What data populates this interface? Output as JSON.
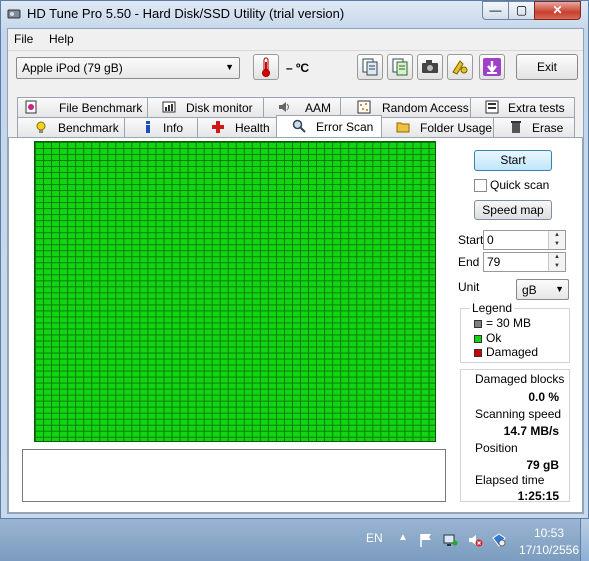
{
  "window": {
    "title": "HD Tune Pro 5.50 - Hard Disk/SSD Utility (trial version)"
  },
  "titlebar_buttons": {
    "minimize": "—",
    "maximize": "▢",
    "close": "✕"
  },
  "menu": {
    "file": "File",
    "help": "Help"
  },
  "toolbar": {
    "drive": "Apple   iPod (79 gB)",
    "temperature": "– ºC",
    "exit_label": "Exit",
    "icons": [
      "copy-info-icon",
      "copy-text-icon",
      "camera-icon",
      "settings-icon",
      "save-icon"
    ]
  },
  "tabs": {
    "row1": [
      "File Benchmark",
      "Disk monitor",
      "AAM",
      "Random Access",
      "Extra tests"
    ],
    "row2": [
      "Benchmark",
      "Info",
      "Health",
      "Error Scan",
      "Folder Usage",
      "Erase"
    ],
    "active": "Error Scan"
  },
  "scan": {
    "start_button": "Start",
    "quick_scan_label": "Quick scan",
    "quick_scan_checked": false,
    "speed_map_button": "Speed map",
    "start_label": "Start",
    "start_value": "0",
    "end_label": "End",
    "end_value": "79",
    "unit_label": "Unit",
    "unit_value": "gB",
    "grid_blocks": {
      "columns": 50,
      "rows": 50,
      "status": "Ok"
    }
  },
  "legend": {
    "title": "Legend",
    "items": [
      {
        "label": "= 30 MB",
        "color": "#808080"
      },
      {
        "label": "Ok",
        "color": "#12d412"
      },
      {
        "label": "Damaged",
        "color": "#cc0000"
      }
    ]
  },
  "stats": {
    "damaged_label": "Damaged blocks",
    "damaged_value": "0.0 %",
    "speed_label": "Scanning speed",
    "speed_value": "14.7 MB/s",
    "position_label": "Position",
    "position_value": "79 gB",
    "elapsed_label": "Elapsed time",
    "elapsed_value": "1:25:15"
  },
  "taskbar": {
    "language": "EN",
    "time": "10:53",
    "date": "17/10/2556",
    "tray_icons": [
      "show-hidden-icons-icon",
      "action-center-flag-icon",
      "network-icon",
      "volume-muted-icon",
      "update-icon"
    ]
  },
  "colors": {
    "ok": "#12d412",
    "damaged": "#cc0000",
    "accent": "#3c7fb1"
  }
}
